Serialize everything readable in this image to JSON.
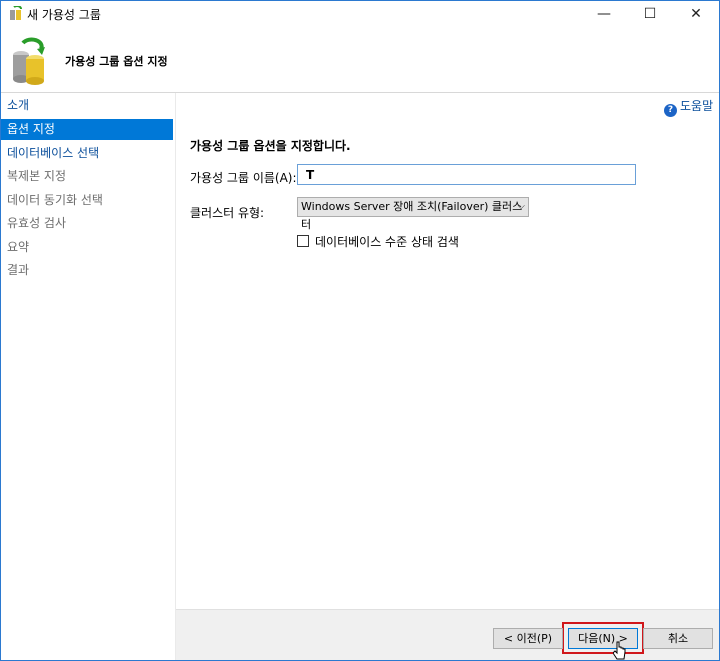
{
  "window": {
    "title": "새 가용성 그룹",
    "controls": {
      "minimize": "—",
      "maximize": "☐",
      "close": "✕"
    }
  },
  "header": {
    "title": "가용성 그룹 옵션 지정",
    "icon": "database-wizard-icon"
  },
  "sidebar": {
    "items": [
      {
        "label": "소개",
        "state": "link"
      },
      {
        "label": "옵션 지정",
        "state": "active"
      },
      {
        "label": "데이터베이스 선택",
        "state": "link"
      },
      {
        "label": "복제본 지정",
        "state": "disabled"
      },
      {
        "label": "데이터 동기화 선택",
        "state": "disabled"
      },
      {
        "label": "유효성 검사",
        "state": "disabled"
      },
      {
        "label": "요약",
        "state": "disabled"
      },
      {
        "label": "결과",
        "state": "disabled"
      }
    ]
  },
  "content": {
    "help": "도움말",
    "section_title": "가용성 그룹 옵션을 지정합니다.",
    "name_label": "가용성 그룹 이름(A):",
    "name_value": "T",
    "cluster_label": "클러스터 유형:",
    "cluster_value": "Windows Server 장애 조치(Failover) 클러스터",
    "checkbox_label": "데이터베이스 수준 상태 검색"
  },
  "footer": {
    "prev": "< 이전(P)",
    "next": "다음(N) >",
    "cancel": "취소"
  },
  "colors": {
    "accent": "#0078d7",
    "highlight": "#d0171b",
    "link": "#0b4f9b"
  }
}
